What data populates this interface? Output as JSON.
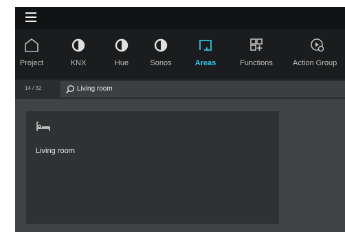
{
  "nav": {
    "items": [
      {
        "label": "Project",
        "icon": "house-icon",
        "active": false
      },
      {
        "label": "KNX",
        "icon": "half-circle-icon",
        "active": false
      },
      {
        "label": "Hue",
        "icon": "half-circle-icon",
        "active": false
      },
      {
        "label": "Sonos",
        "icon": "half-circle-icon",
        "active": false
      },
      {
        "label": "Areas",
        "icon": "area-icon",
        "active": true
      },
      {
        "label": "Functions",
        "icon": "functions-grid-icon",
        "active": false
      },
      {
        "label": "Action Group",
        "icon": "play-gear-icon",
        "active": false
      }
    ]
  },
  "subbar": {
    "counter": "14 / 32",
    "search_value": "Living room"
  },
  "cards": [
    {
      "name": "Living room",
      "icon": "bed-icon"
    }
  ],
  "colors": {
    "accent": "#27c4e8",
    "topbar": "#111213",
    "navbar": "#1b1c1d",
    "content": "#404244",
    "card": "#2f3133"
  }
}
